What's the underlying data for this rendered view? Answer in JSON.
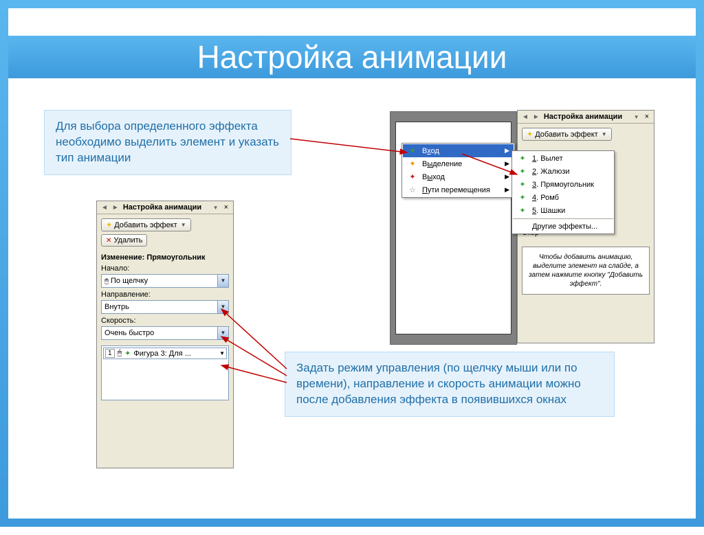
{
  "title": "Настройка анимации",
  "callout1": "Для выбора определенного эффекта необходимо выделить элемент и указать тип анимации",
  "callout2": "Задать режим управления (по щелчку мыши или по времени), направление и скорость анимации можно после добавления эффекта в появившихся окнах",
  "panelLeft": {
    "headerTitle": "Настройка анимации",
    "addEffect": "Добавить эффект",
    "remove": "Удалить",
    "changeLabel": "Изменение: Прямоугольник",
    "startLabel": "Начало:",
    "startValue": "По щелчку",
    "directionLabel": "Направление:",
    "directionValue": "Внутрь",
    "speedLabel": "Скорость:",
    "speedValue": "Очень быстро",
    "listItemNum": "1",
    "listItemText": "Фигура 3: Для ..."
  },
  "panelRight": {
    "headerTitle": "Настройка анимации",
    "addEffect": "Добавить эффект",
    "speedPrefix": "Скор",
    "hintText": "Чтобы добавить анимацию, выделите элемент на слайде, а затем нажмите кнопку \"Добавить эффект\"."
  },
  "menu1": {
    "items": [
      {
        "label": "Вход",
        "hotkey": "х",
        "icon": "star-green",
        "hover": true
      },
      {
        "label": "Выделение",
        "hotkey": "ы",
        "icon": "star-orange"
      },
      {
        "label": "Выход",
        "hotkey": "ы",
        "icon": "star-red"
      },
      {
        "label": "Пути перемещения",
        "hotkey": "П",
        "icon": "star-path"
      }
    ]
  },
  "menu2": {
    "items": [
      {
        "num": "1",
        "label": "Вылет"
      },
      {
        "num": "2",
        "label": "Жалюзи"
      },
      {
        "num": "3",
        "label": "Прямоугольник"
      },
      {
        "num": "4",
        "label": "Ромб"
      },
      {
        "num": "5",
        "label": "Шашки"
      }
    ],
    "other": "Другие эффекты..."
  }
}
